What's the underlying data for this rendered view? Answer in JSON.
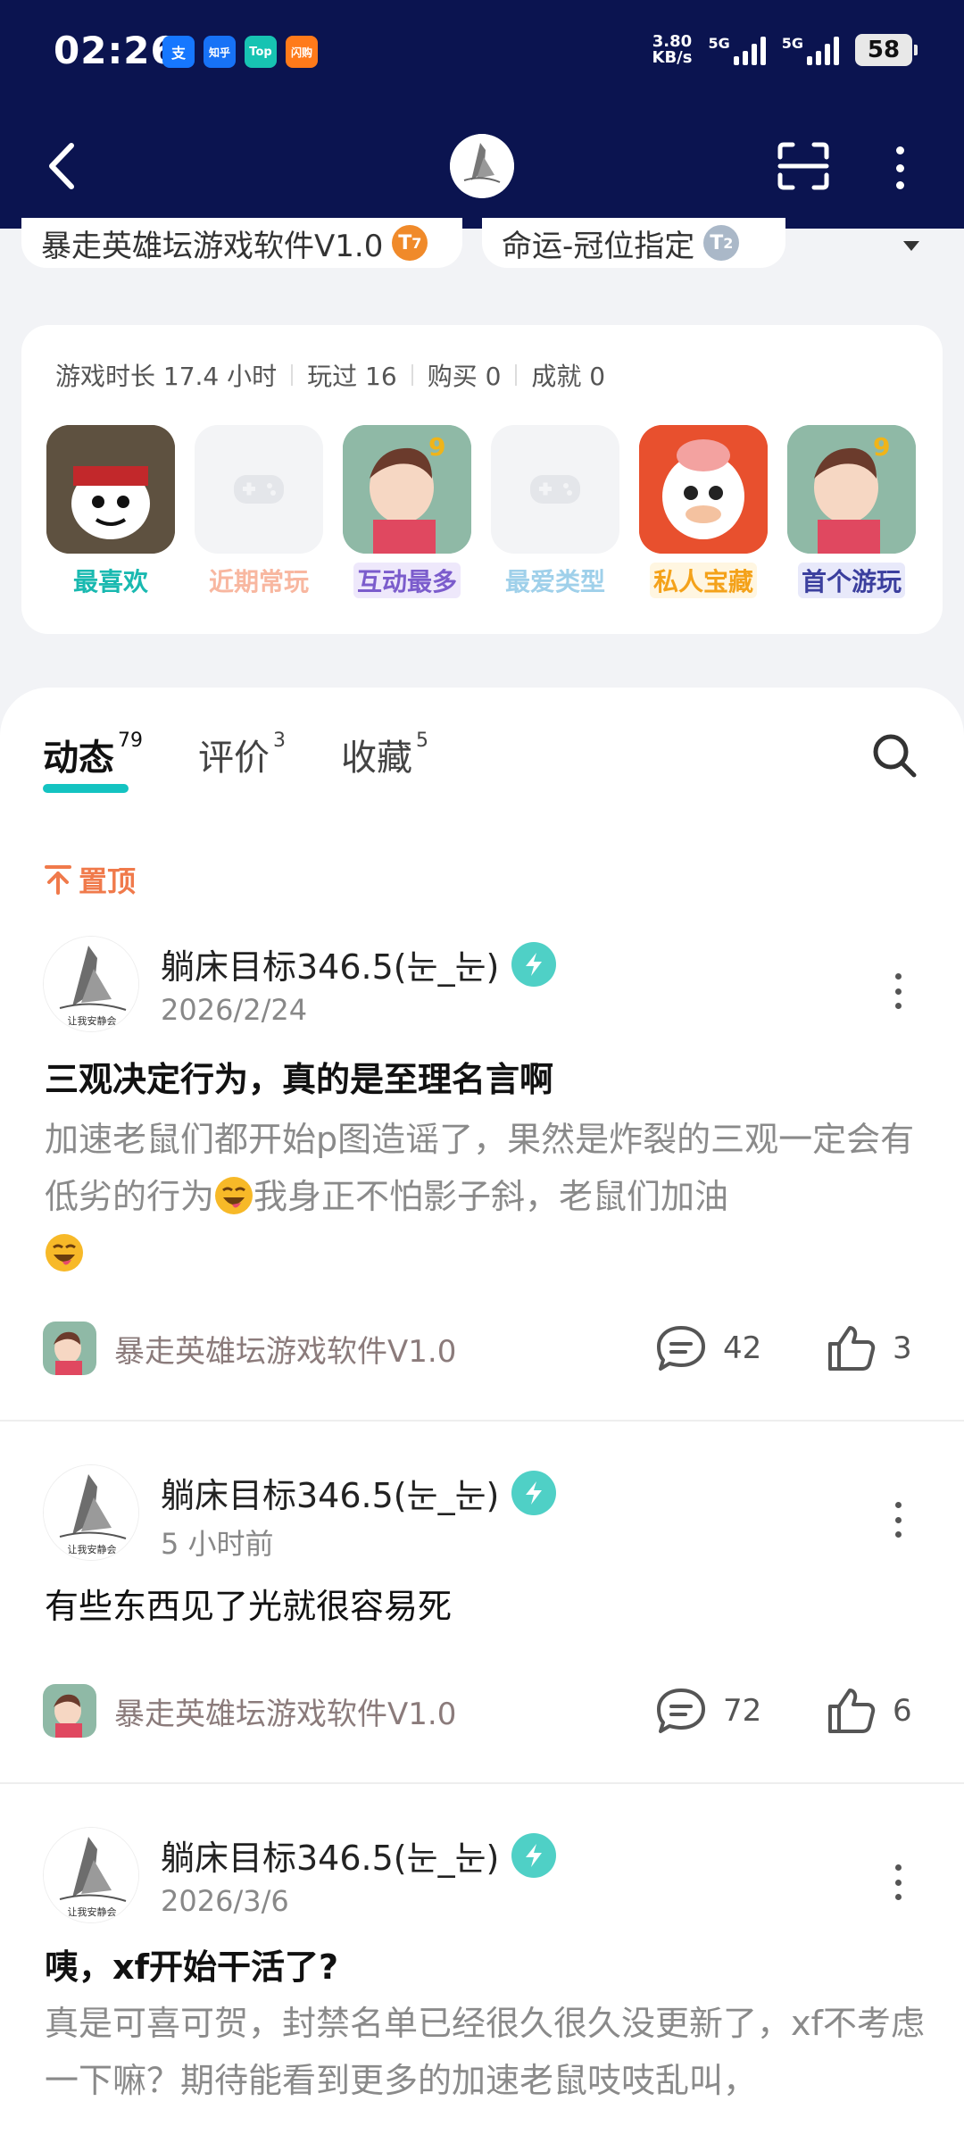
{
  "statusbar": {
    "time": "02:26",
    "apps": [
      {
        "label": "支",
        "color": "#1677ff"
      },
      {
        "label": "知乎",
        "color": "#1772f6"
      },
      {
        "label": "Top",
        "color": "#17c3b2"
      },
      {
        "label": "闪购",
        "color": "#ff7a1a"
      }
    ],
    "speed_value": "3.80",
    "speed_unit": "KB/s",
    "net1": "5G",
    "net2": "5G",
    "battery": "58"
  },
  "header": {
    "chip1_label": "暴走英雄坛游戏软件V1.0",
    "chip1_badge": "7",
    "chip2_label": "命运-冠位指定",
    "chip2_badge": "2"
  },
  "stats": {
    "play_time": "游戏时长 17.4 小时",
    "played": "玩过 16",
    "bought": "购买 0",
    "achievements": "成就 0"
  },
  "games": [
    {
      "label": "最喜欢",
      "color": "#19b9b0",
      "bg": "#ffffff"
    },
    {
      "label": "近期常玩",
      "color": "#f8b7a0",
      "bg": "#ffffff"
    },
    {
      "label": "互动最多",
      "color": "#7b5ccc",
      "bg": "#eee8fb"
    },
    {
      "label": "最爱类型",
      "color": "#9fd0ea",
      "bg": "#ffffff"
    },
    {
      "label": "私人宝藏",
      "color": "#f4a21a",
      "bg": "#fff6e1"
    },
    {
      "label": "首个游玩",
      "color": "#3b3f9e",
      "bg": "#e8e9fa"
    }
  ],
  "tabs": [
    {
      "label": "动态",
      "count": "79"
    },
    {
      "label": "评价",
      "count": "3"
    },
    {
      "label": "收藏",
      "count": "5"
    }
  ],
  "pinned_label": "置顶",
  "posts": [
    {
      "author": "躺床目标346.5(눈_눈)",
      "date": "2026/2/24",
      "title": "三观决定行为，真的是至理名言啊",
      "body_1": "加速老鼠们都开始p图造谣了，果然是炸裂的三观一定会有低劣的行为",
      "body_2": "我身正不怕影子斜，老鼠们加油",
      "game": "暴走英雄坛游戏软件V1.0",
      "comments": "42",
      "likes": "3"
    },
    {
      "author": "躺床目标346.5(눈_눈)",
      "date": "5 小时前",
      "title": "有些东西见了光就很容易死",
      "game": "暴走英雄坛游戏软件V1.0",
      "comments": "72",
      "likes": "6"
    },
    {
      "author": "躺床目标346.5(눈_눈)",
      "date": "2026/3/6",
      "title": "咦，xf开始干活了?",
      "body_1": "真是可喜可贺，封禁名单已经很久很久没更新了，xf不考虑一下嘛？期待能看到更多的加速老鼠吱吱乱叫，"
    }
  ]
}
